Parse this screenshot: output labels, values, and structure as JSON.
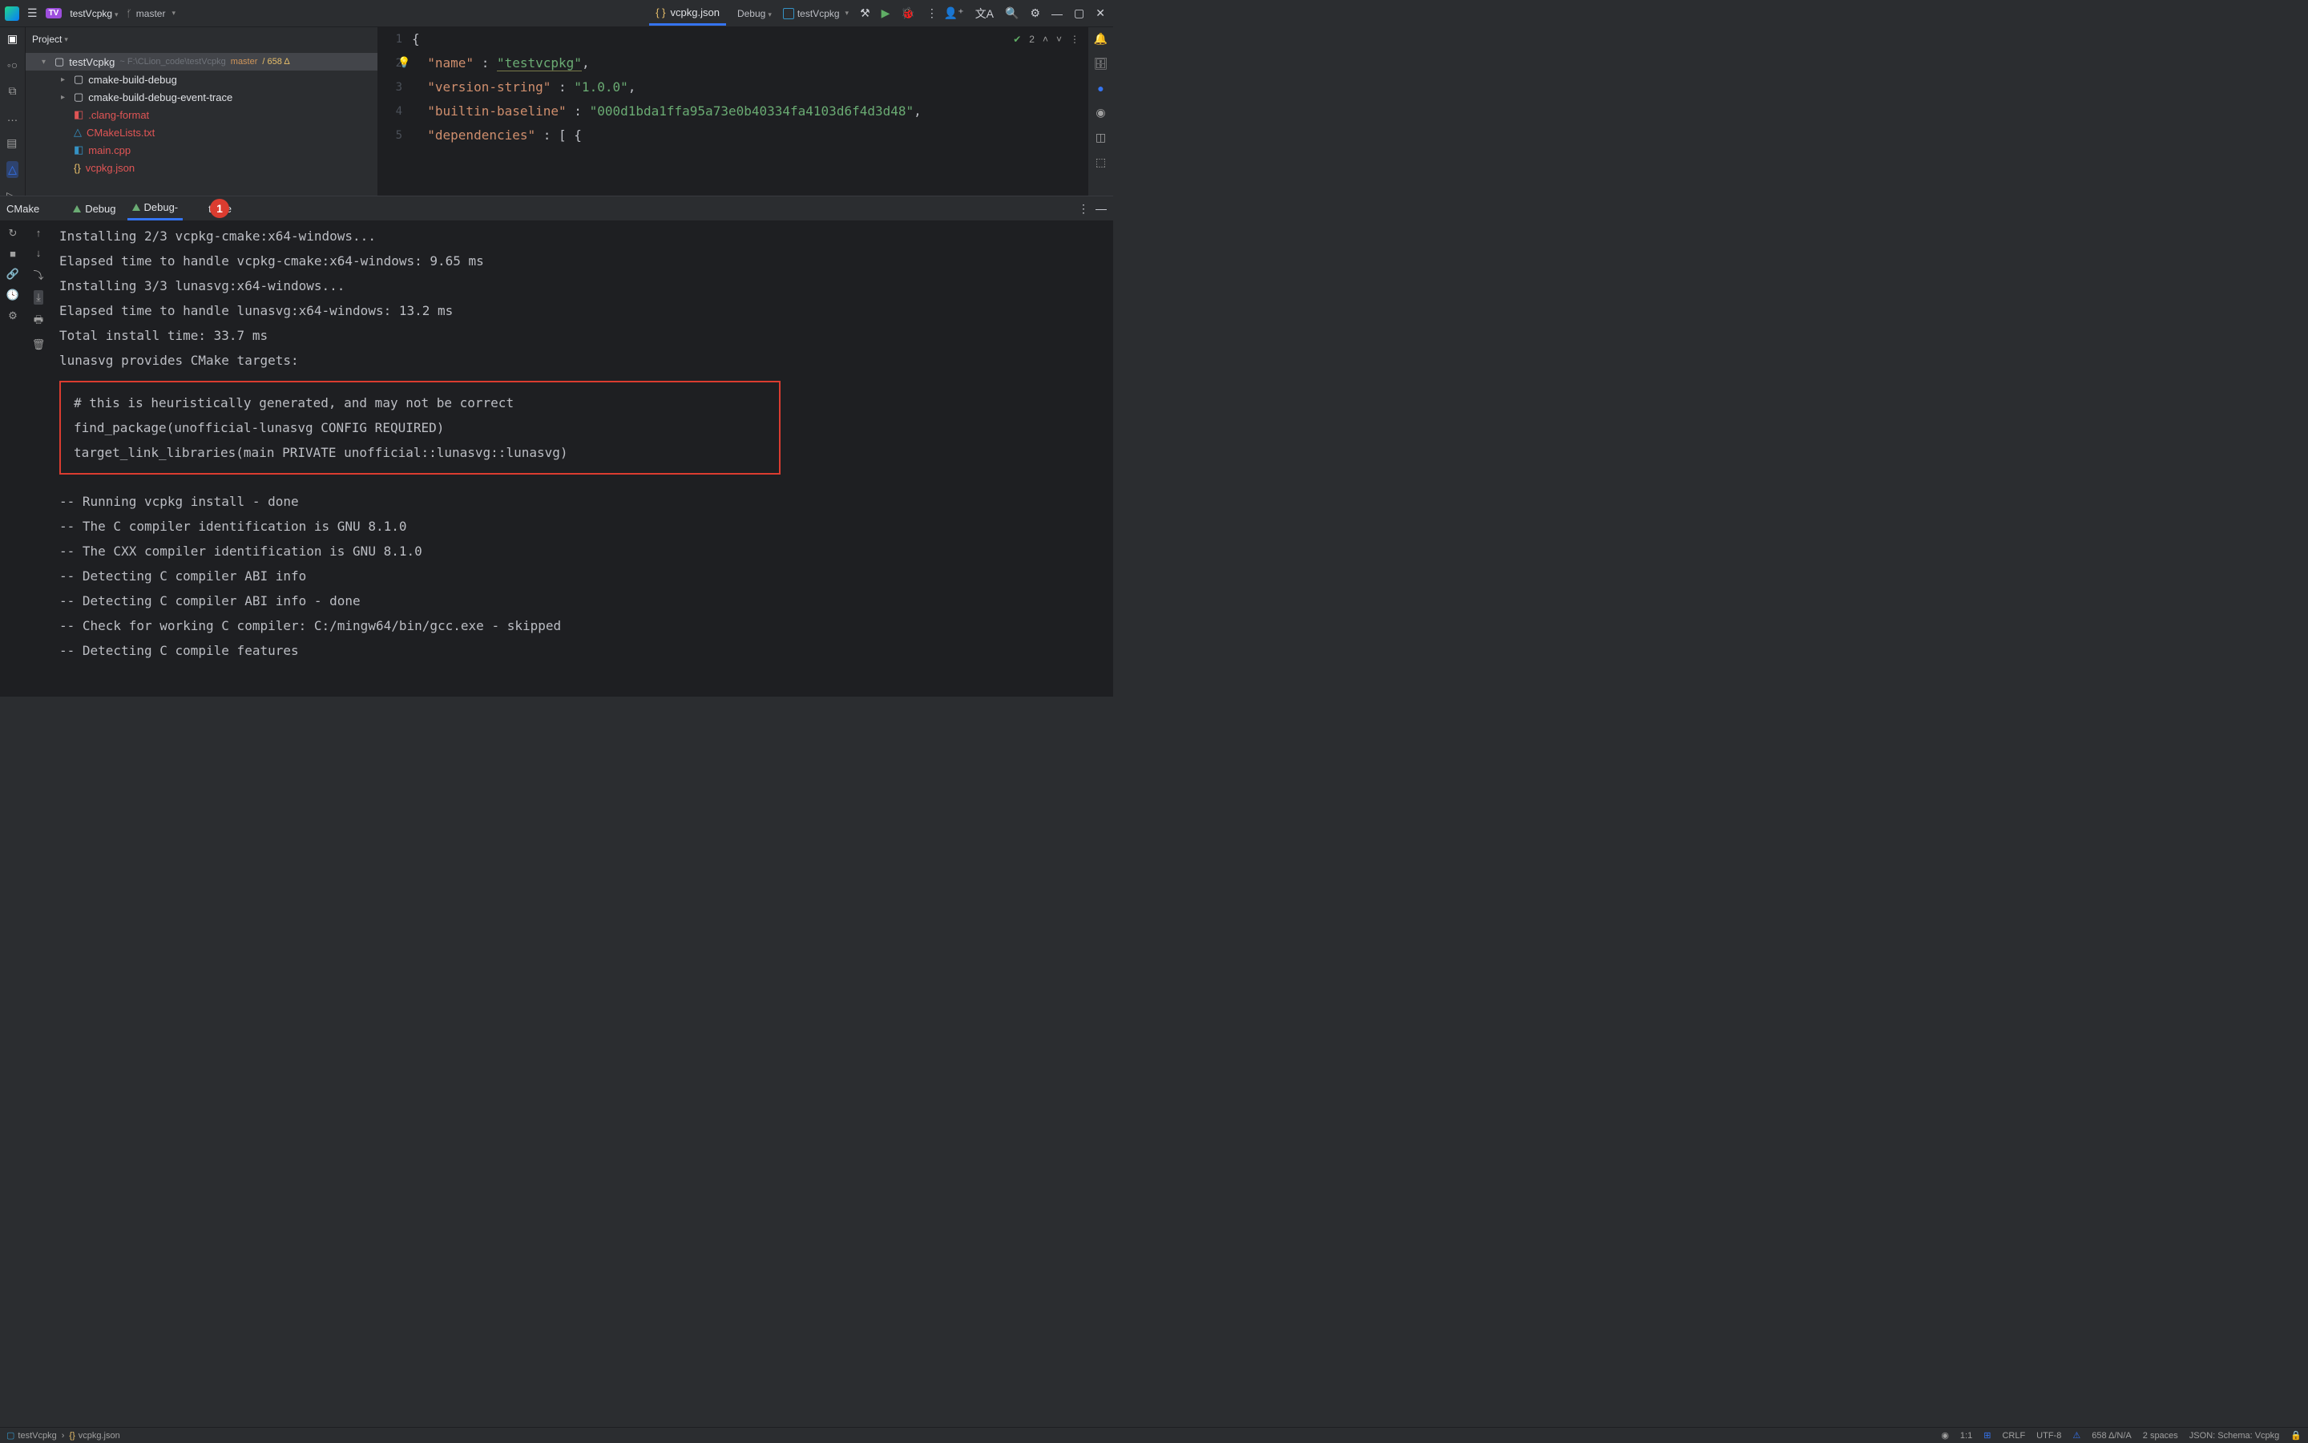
{
  "titlebar": {
    "project": "testVcpkg",
    "project_badge": "TV",
    "branch_label": "master",
    "open_file": "vcpkg.json",
    "config_label": "Debug",
    "run_target": "testVcpkg"
  },
  "sidebar": {
    "header": "Project",
    "root": {
      "name": "testVcpkg",
      "path": "~ F:\\CLion_code\\testVcpkg",
      "branch": "master",
      "changes": "/ 658 Δ"
    },
    "folders": [
      "cmake-build-debug",
      "cmake-build-debug-event-trace"
    ],
    "files": [
      ".clang-format",
      "CMakeLists.txt",
      "main.cpp",
      "vcpkg.json"
    ]
  },
  "editor": {
    "lines": [
      "1",
      "2",
      "3",
      "4",
      "5"
    ],
    "code": {
      "l1": "{",
      "l2_key": "\"name\"",
      "l2_val": "\"testvcpkg\"",
      "l3_key": "\"version-string\"",
      "l3_val": "\"1.0.0\"",
      "l4_key": "\"builtin-baseline\"",
      "l4_val": "\"000d1bda1ffa95a73e0b40334fa4103d6f4d3d48\"",
      "l5_key": "\"dependencies\"",
      "l5_rest": " : [ {"
    },
    "hints": {
      "check_count": "2"
    }
  },
  "bottom_panel": {
    "label": "CMake",
    "tabs": [
      "Debug",
      "Debug-",
      "trace"
    ],
    "badge": "1",
    "console_lines": [
      "Installing 2/3 vcpkg-cmake:x64-windows...",
      "Elapsed time to handle vcpkg-cmake:x64-windows: 9.65 ms",
      "Installing 3/3 lunasvg:x64-windows...",
      "Elapsed time to handle lunasvg:x64-windows: 13.2 ms",
      "Total install time: 33.7 ms",
      "lunasvg provides CMake targets:"
    ],
    "highlighted": [
      "# this is heuristically generated, and may not be correct",
      "find_package(unofficial-lunasvg CONFIG REQUIRED)",
      "target_link_libraries(main PRIVATE unofficial::lunasvg::lunasvg)"
    ],
    "console_lines2": [
      "-- Running vcpkg install - done",
      "-- The C compiler identification is GNU 8.1.0",
      "-- The CXX compiler identification is GNU 8.1.0",
      "-- Detecting C compiler ABI info",
      "-- Detecting C compiler ABI info - done",
      "-- Check for working C compiler: C:/mingw64/bin/gcc.exe - skipped",
      "-- Detecting C compile features"
    ]
  },
  "breadcrumb": {
    "items": [
      "testVcpkg",
      "vcpkg.json"
    ]
  },
  "status": {
    "pos": "1:1",
    "eol": "CRLF",
    "enc": "UTF-8",
    "problems": "658 Δ/N/A",
    "indent": "2 spaces",
    "schema": "JSON: Schema: Vcpkg"
  }
}
